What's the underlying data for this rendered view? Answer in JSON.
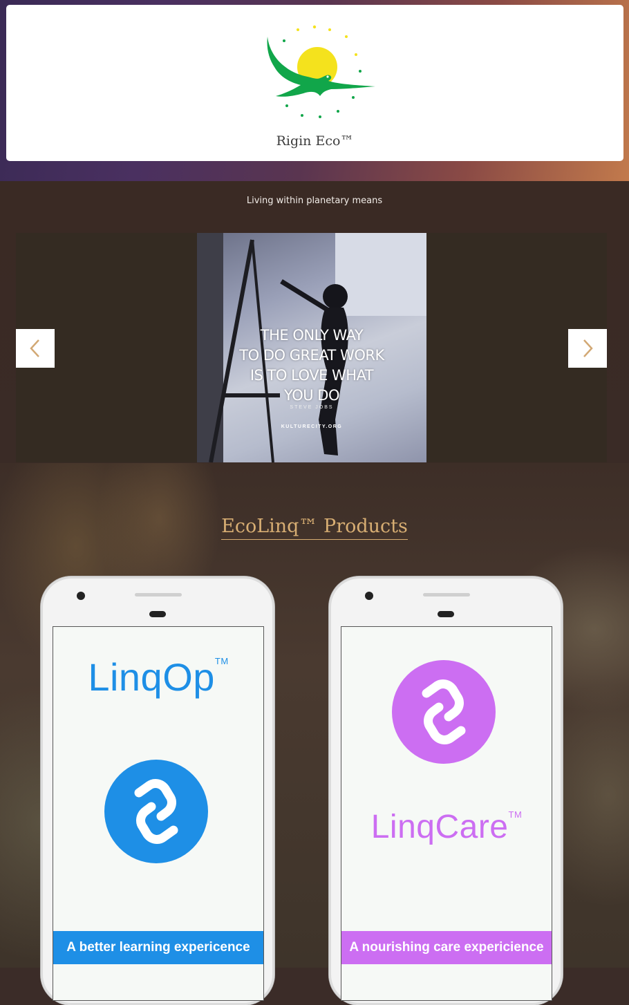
{
  "header": {
    "brand_name": "Rigin Eco™"
  },
  "tagline": "Living within planetary means",
  "carousel": {
    "quote_lines": [
      "THE ONLY WAY",
      "TO DO GREAT WORK",
      "IS TO LOVE WHAT",
      "YOU DO"
    ],
    "quote_author": "STEVE JOBS",
    "quote_source": "KULTURECITY.ORG",
    "prev_icon": "chevron-left-icon",
    "next_icon": "chevron-right-icon"
  },
  "products": {
    "title": "EcoLinq™ Products",
    "items": [
      {
        "name": "LinqOp",
        "tm": "TM",
        "tagline": "A better learning expericence",
        "color": "#1e8fe6",
        "icon": "link-icon"
      },
      {
        "name": "LinqCare",
        "tm": "TM",
        "tagline": "A nourishing care expericience",
        "color": "#cc6ef2",
        "icon": "link-icon"
      }
    ]
  },
  "colors": {
    "accent_gold": "#d8ae73",
    "logo_green": "#11a64a",
    "logo_yellow": "#f4e21d"
  }
}
